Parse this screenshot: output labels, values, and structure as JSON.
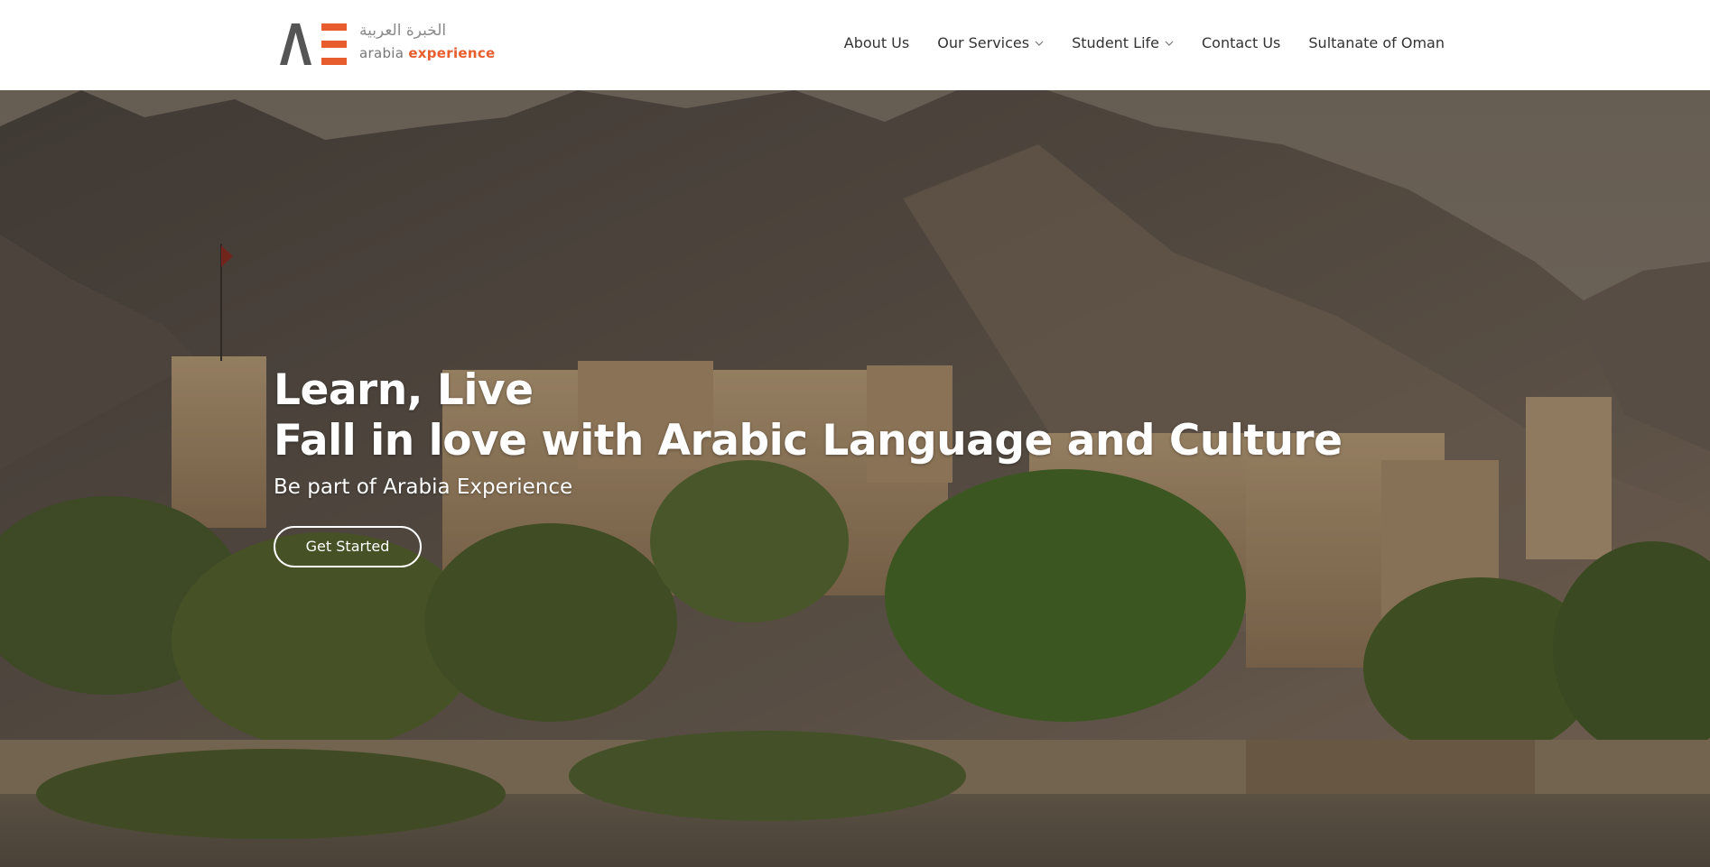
{
  "header": {
    "logo": {
      "arabic_text": "الخبرة العربية",
      "latin_word1": "arabia",
      "latin_word2": "experience",
      "mark_color_dark": "#555555",
      "mark_color_accent": "#e85d2e"
    },
    "nav": {
      "items": [
        {
          "label": "About Us",
          "has_dropdown": false
        },
        {
          "label": "Our Services",
          "has_dropdown": true
        },
        {
          "label": "Student Life",
          "has_dropdown": true
        },
        {
          "label": "Contact Us",
          "has_dropdown": false
        },
        {
          "label": "Sultanate of Oman",
          "has_dropdown": false
        }
      ]
    }
  },
  "hero": {
    "title_line1": "Learn, Live",
    "title_line2": "Fall in love with Arabic Language and Culture",
    "subtitle": "Be part of Arabia Experience",
    "cta_label": "Get Started"
  },
  "colors": {
    "accent": "#e85d2e",
    "nav_text": "#333333",
    "hero_text": "#ffffff"
  }
}
